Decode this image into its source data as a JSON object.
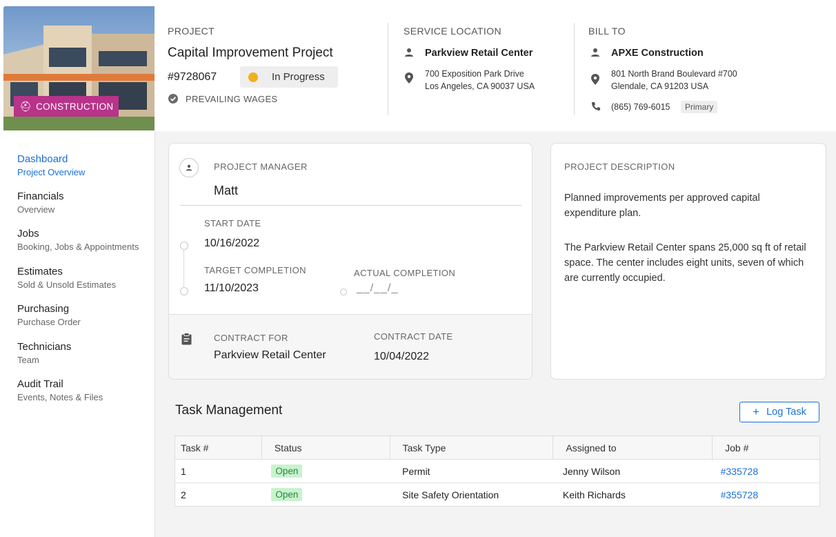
{
  "header": {
    "category_badge": "CONSTRUCTION",
    "project": {
      "label": "PROJECT",
      "title": "Capital Improvement Project",
      "number": "#9728067",
      "status": "In Progress",
      "status_color": "#f2b01e",
      "prevailing": "PREVAILING WAGES"
    },
    "service_location": {
      "label": "SERVICE LOCATION",
      "name": "Parkview Retail Center",
      "address_line1": "700 Exposition Park Drive",
      "address_line2": "Los Angeles, CA 90037 USA"
    },
    "bill_to": {
      "label": "BILL TO",
      "name": "APXE Construction",
      "address_line1": "801 North Brand Boulevard #700",
      "address_line2": "Glendale, CA 91203 USA",
      "phone": "(865) 769-6015",
      "phone_tag": "Primary"
    }
  },
  "sidebar": {
    "items": [
      {
        "title": "Dashboard",
        "sub": "Project Overview",
        "active": true
      },
      {
        "title": "Financials",
        "sub": "Overview"
      },
      {
        "title": "Jobs",
        "sub": "Booking, Jobs & Appointments"
      },
      {
        "title": "Estimates",
        "sub": "Sold & Unsold Estimates"
      },
      {
        "title": "Purchasing",
        "sub": "Purchase Order"
      },
      {
        "title": "Technicians",
        "sub": "Team"
      },
      {
        "title": "Audit Trail",
        "sub": "Events, Notes & Files"
      }
    ]
  },
  "overview": {
    "manager_label": "PROJECT MANAGER",
    "manager_name": "Matt",
    "start_label": "START DATE",
    "start_value": "10/16/2022",
    "target_label": "TARGET COMPLETION",
    "target_value": "11/10/2023",
    "actual_label": "ACTUAL COMPLETION",
    "actual_value": "__/__/_",
    "contract_for_label": "CONTRACT FOR",
    "contract_for_value": "Parkview Retail Center",
    "contract_date_label": "CONTRACT DATE",
    "contract_date_value": "10/04/2022"
  },
  "description": {
    "label": "PROJECT DESCRIPTION",
    "para1": "Planned improvements per approved capital expenditure plan.",
    "para2": "The Parkview Retail Center spans 25,000 sq ft of retail space. The center includes eight units, seven of which are currently occupied."
  },
  "tasks": {
    "title": "Task Management",
    "log_button": "Log Task",
    "log_button_icon": "+",
    "columns": [
      "Task #",
      "Status",
      "Task Type",
      "Assigned to",
      "Job #"
    ],
    "rows": [
      {
        "num": "1",
        "status": "Open",
        "type": "Permit",
        "assigned": "Jenny Wilson",
        "job": "#335728"
      },
      {
        "num": "2",
        "status": "Open",
        "type": "Site Safety Orientation",
        "assigned": "Keith Richards",
        "job": "#355728"
      }
    ]
  },
  "colors": {
    "accent": "#1a6fd8",
    "badge": "#b8338a",
    "open_bg": "#c9f2cf",
    "open_text": "#238a3b"
  }
}
